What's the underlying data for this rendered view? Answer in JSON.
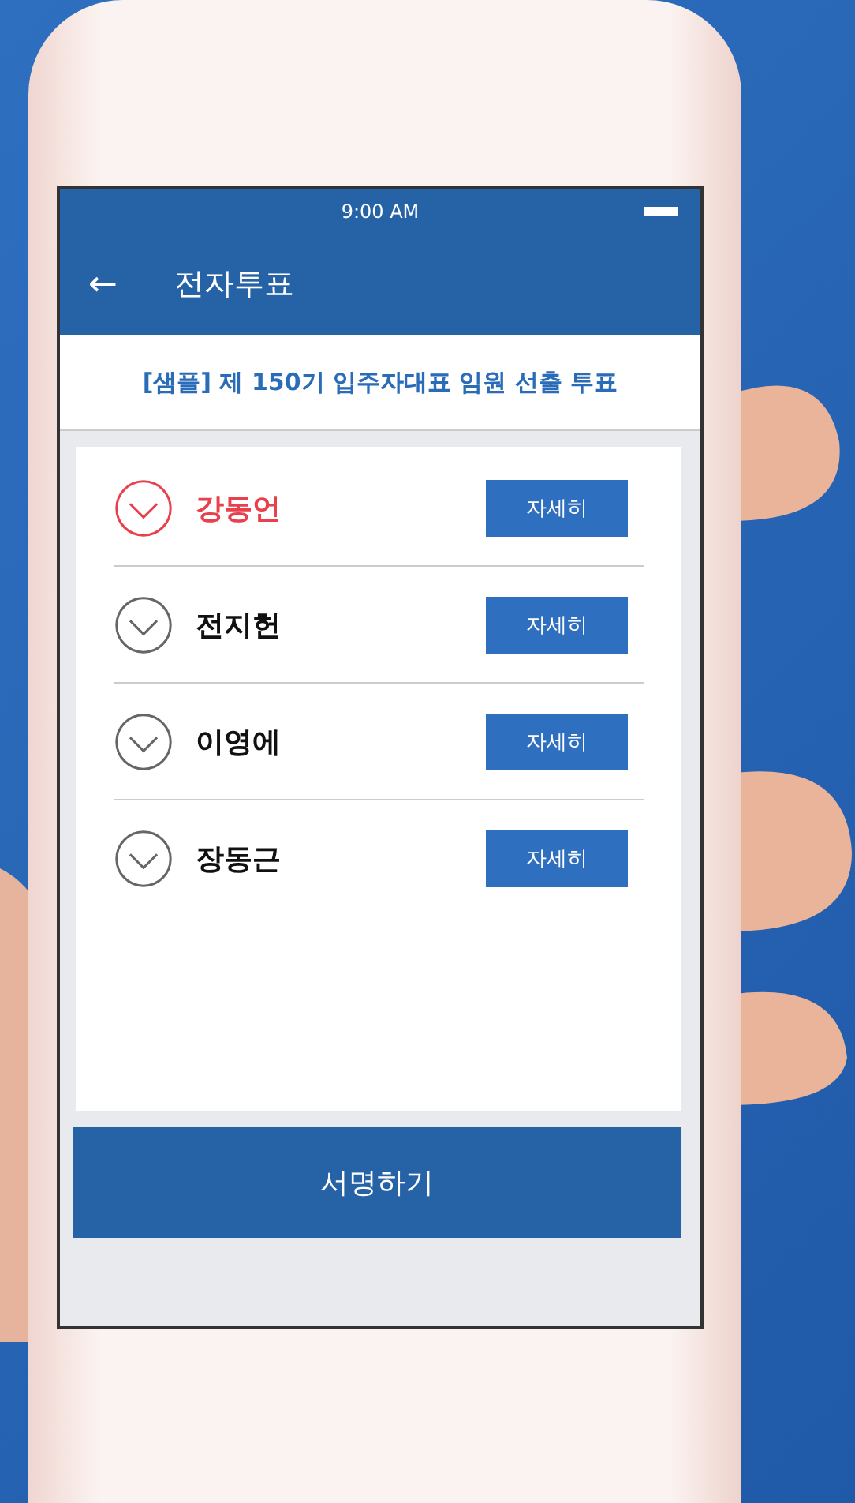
{
  "status_bar": {
    "time": "9:00 AM"
  },
  "header": {
    "back": "←",
    "title": "전자투표"
  },
  "subtitle": "[샘플] 제 150기 입주자대표 임원 선출 투표",
  "candidates": [
    {
      "name": "강동언",
      "selected": true,
      "button": "자세히"
    },
    {
      "name": "전지헌",
      "selected": false,
      "button": "자세히"
    },
    {
      "name": "이영에",
      "selected": false,
      "button": "자세히"
    },
    {
      "name": "장동근",
      "selected": false,
      "button": "자세히"
    }
  ],
  "submit_button": "서명하기"
}
